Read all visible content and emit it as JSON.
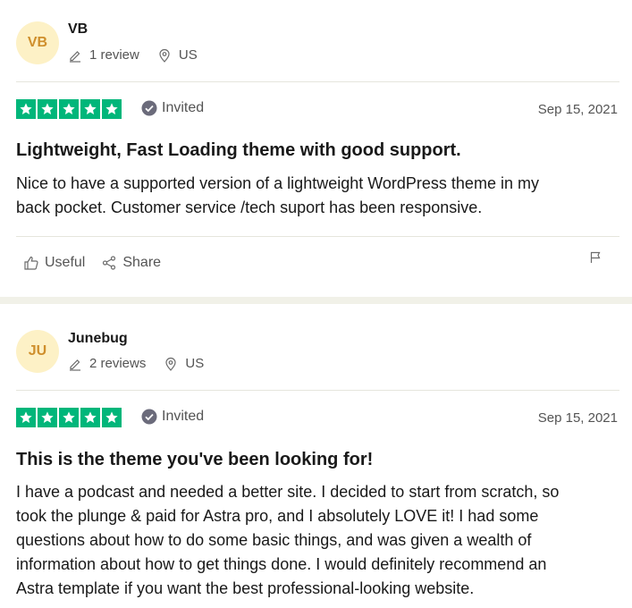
{
  "reviews": [
    {
      "initials": "VB",
      "name": "VB",
      "review_count": "1 review",
      "country": "US",
      "rating": 5,
      "verification": "Invited",
      "date": "Sep 15, 2021",
      "title": "Lightweight, Fast Loading theme with good support.",
      "body_lines": [
        "Nice to have a supported version of a lightweight WordPress theme in my",
        "back pocket. Customer service /tech suport has been responsive."
      ],
      "useful_label": "Useful",
      "share_label": "Share"
    },
    {
      "initials": "JU",
      "name": "Junebug",
      "review_count": "2 reviews",
      "country": "US",
      "rating": 5,
      "verification": "Invited",
      "date": "Sep 15, 2021",
      "title": "This is the theme you've been looking for!",
      "body_lines": [
        "I have a podcast and needed a better site. I decided to start from scratch, so",
        "took the plunge & paid for Astra pro, and I absolutely LOVE it! I had some",
        "questions about how to do some basic things, and was given a wealth of",
        "information about how to get things done. I would definitely recommend an",
        "Astra template if you want the best professional-looking website."
      ]
    }
  ],
  "colors": {
    "star_green": "#00b67a",
    "avatar_bg": "#fdf1c6",
    "avatar_text": "#cf8f2c"
  }
}
